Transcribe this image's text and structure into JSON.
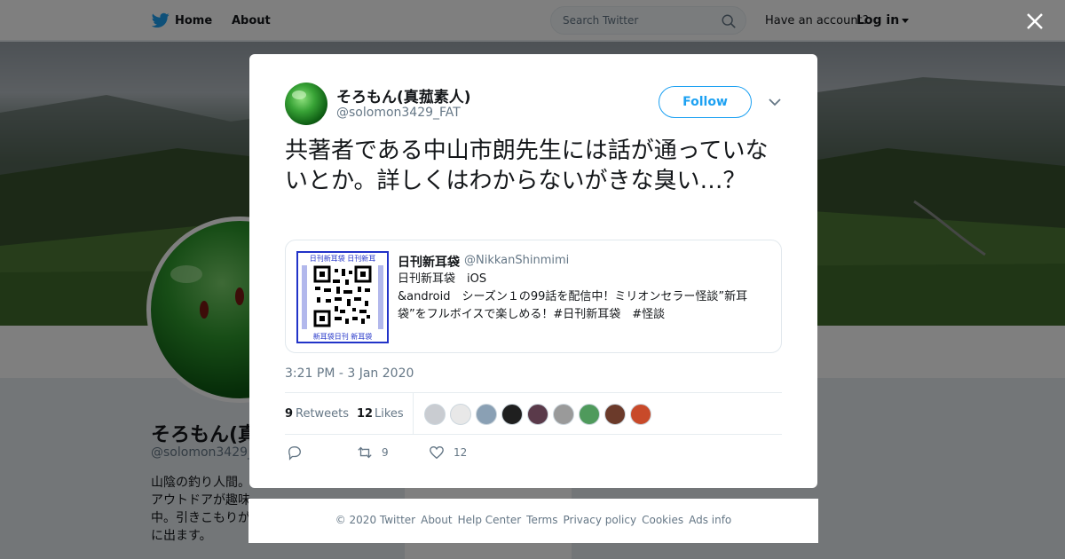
{
  "nav": {
    "home_label": "Home",
    "about_label": "About",
    "search_placeholder": "Search Twitter",
    "have_account": "Have an account?",
    "login_label": "Log in"
  },
  "background_profile": {
    "name": "そろもん(真",
    "handle": "@solomon3429_",
    "bio_lines": [
      "山陰の釣り人間。",
      "アウトドアが趣味。",
      "中。引きこもりが",
      "に出ます。"
    ]
  },
  "tweet": {
    "author_name": "そろもん(真菰素人)",
    "author_handle": "@solomon3429_FAT",
    "follow_label": "Follow",
    "text": "共著者である中山市朗先生には話が通っていないとか。詳しくはわからないがきな臭い…？",
    "quoted": {
      "name": "日刊新耳袋",
      "handle": "@NikkanShinmimi",
      "text": "日刊新耳袋　iOS\n&android　シーズン１の99話を配信中！ミリオンセラー怪談”新耳袋”をフルボイスで楽しめる！#日刊新耳袋　#怪談",
      "qr_caption_top": "日刊新耳袋 日刊新耳",
      "qr_caption_bottom": "新耳袋日刊 新耳袋"
    },
    "timestamp": "3:21 PM - 3 Jan 2020",
    "retweets_count": "9",
    "retweets_label": "Retweets",
    "likes_count": "12",
    "likes_label": "Likes",
    "action_retweet_count": "9",
    "action_like_count": "12"
  },
  "liker_avatar_colors": [
    "#c9ccd1",
    "#e8e8e8",
    "#8aa0b4",
    "#1f1f1f",
    "#5a3a4a",
    "#9a9a9a",
    "#4f9a5c",
    "#6b3a2a",
    "#c84a2a"
  ],
  "footer": {
    "links": [
      "© 2020 Twitter",
      "About",
      "Help Center",
      "Terms",
      "Privacy policy",
      "Cookies",
      "Ads info"
    ]
  },
  "colors": {
    "accent": "#1da1f2",
    "overlay": "rgba(0,0,0,0.5)"
  },
  "icons": [
    "twitter-bird-icon",
    "search-icon",
    "close-icon",
    "chevron-down-icon",
    "reply-icon",
    "retweet-icon",
    "like-icon"
  ]
}
